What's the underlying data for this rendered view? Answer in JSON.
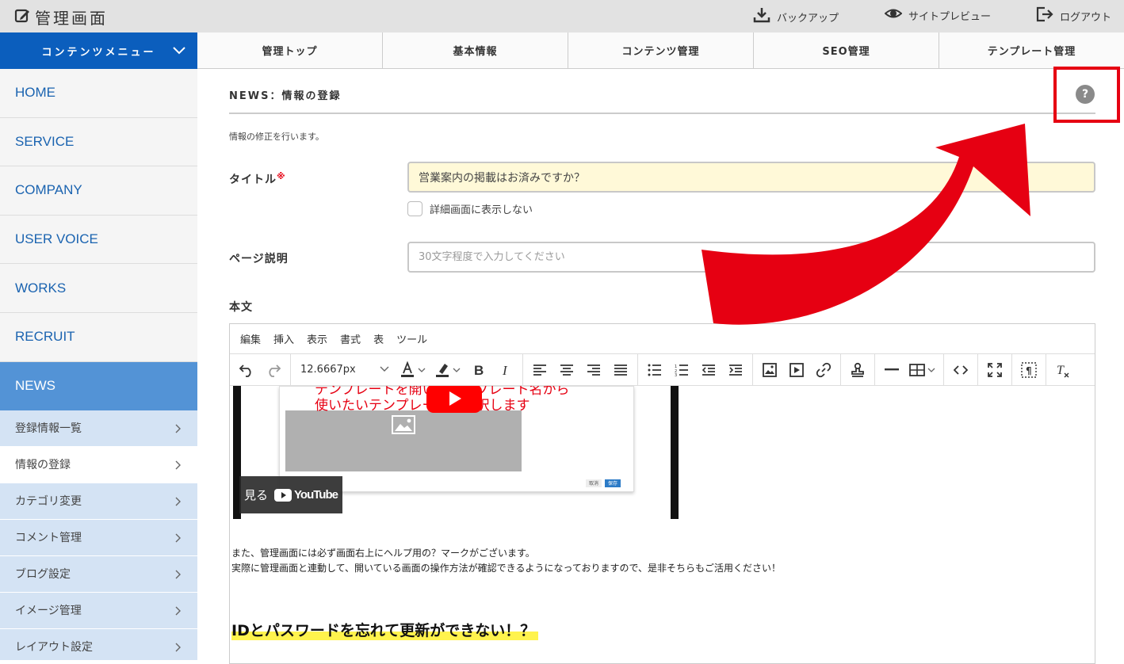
{
  "header": {
    "app_title": "管理画面",
    "backup_label": "バックアップ",
    "preview_label": "サイトプレビュー",
    "logout_label": "ログアウト"
  },
  "sidebar": {
    "menu_title": "コンテンツメニュー",
    "items": [
      {
        "label": "HOME"
      },
      {
        "label": "SERVICE"
      },
      {
        "label": "COMPANY"
      },
      {
        "label": "USER VOICE"
      },
      {
        "label": "WORKS"
      },
      {
        "label": "RECRUIT"
      },
      {
        "label": "NEWS"
      }
    ],
    "sub_items": [
      {
        "label": "登録情報一覧"
      },
      {
        "label": "情報の登録"
      },
      {
        "label": "カテゴリ変更"
      },
      {
        "label": "コメント管理"
      },
      {
        "label": "ブログ設定"
      },
      {
        "label": "イメージ管理"
      },
      {
        "label": "レイアウト設定"
      }
    ]
  },
  "tabs": [
    {
      "label": "管理トップ"
    },
    {
      "label": "基本情報"
    },
    {
      "label": "コンテンツ管理"
    },
    {
      "label": "SEO管理"
    },
    {
      "label": "テンプレート管理"
    }
  ],
  "page": {
    "title": "NEWS：情報の登録",
    "help_label": "?",
    "description": "情報の修正を行います。"
  },
  "form": {
    "title_label": "タイトル",
    "required_mark": "※",
    "title_value": "営業案内の掲載はお済みですか？",
    "hide_checkbox_label": "詳細画面に表示しない",
    "page_desc_label": "ページ説明",
    "page_desc_placeholder": "30文字程度で入力してください",
    "body_label": "本文"
  },
  "editor": {
    "menus": [
      "編集",
      "挿入",
      "表示",
      "書式",
      "表",
      "ツール"
    ],
    "font_size": "12.6667px",
    "video": {
      "caption_line1": "テンプレートを開いてテンプレート名から",
      "caption_line2": "使いたいテンプレートを選択します",
      "watch_label": "見る",
      "youtube_label": "YouTube",
      "cancel_label": "取消",
      "save_label": "保存"
    },
    "paragraph_line1": "また、管理画面には必ず画面右上にヘルプ用の？マークがございます。",
    "paragraph_line2": "実際に管理画面と連動して、開いている画面の操作方法が確認できるようになっておりますので、是非そちらもご活用ください！",
    "heading": "IDとパスワードを忘れて更新ができない！？"
  },
  "colors": {
    "brand_blue": "#0b5ebd",
    "active_blue": "#5393d6",
    "sub_menu_bg": "#d4e3f4",
    "annotation_red": "#e60012",
    "title_input_bg": "#fff9d8",
    "heading_marker": "#fff34d"
  }
}
